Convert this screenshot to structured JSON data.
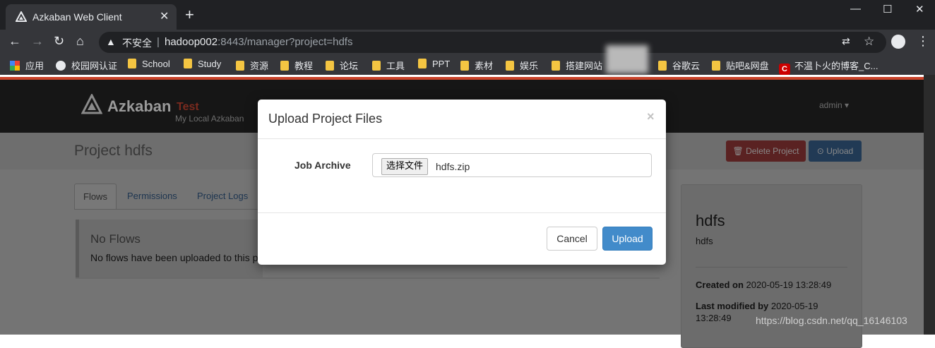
{
  "browser": {
    "tab_title": "Azkaban Web Client",
    "tab_close": "✕",
    "new_tab": "+",
    "insecure_label": "不安全",
    "url_host": "hadoop002",
    "url_rest": ":8443/manager?project=hdfs",
    "bookmarks": [
      {
        "label": "应用",
        "icon": "apps-grid-icon"
      },
      {
        "label": "校园网认证",
        "icon": "globe-icon"
      },
      {
        "label": "School",
        "icon": "folder-icon"
      },
      {
        "label": "Study",
        "icon": "folder-icon"
      },
      {
        "label": "资源",
        "icon": "folder-icon"
      },
      {
        "label": "教程",
        "icon": "folder-icon"
      },
      {
        "label": "论坛",
        "icon": "folder-icon"
      },
      {
        "label": "工具",
        "icon": "folder-icon"
      },
      {
        "label": "PPT",
        "icon": "folder-icon"
      },
      {
        "label": "素材",
        "icon": "folder-icon"
      },
      {
        "label": "娱乐",
        "icon": "folder-icon"
      },
      {
        "label": "搭建网站",
        "icon": "folder-icon"
      },
      {
        "label": "谷歌云",
        "icon": "folder-icon"
      },
      {
        "label": "贴吧&网盘",
        "icon": "folder-icon"
      },
      {
        "label": "不温卜火的博客_C...",
        "icon": "csdn-icon"
      }
    ]
  },
  "azkaban": {
    "brand": "Azkaban",
    "env": "Test",
    "subtitle": "My Local Azkaban",
    "user": "admin",
    "page_title": "Project hdfs",
    "delete_project": "Delete Project",
    "upload": "Upload",
    "tabs": [
      "Flows",
      "Permissions",
      "Project Logs"
    ],
    "no_flows_title": "No Flows",
    "no_flows_text": "No flows have been uploaded to this p",
    "project": {
      "name": "hdfs",
      "description": "hdfs",
      "created_label": "Created on",
      "created_value": "2020-05-19 13:28:49",
      "modified_label": "Last modified by",
      "modified_value": "2020-05-19",
      "modified_time": "13:28:49"
    }
  },
  "modal": {
    "title": "Upload Project Files",
    "close": "×",
    "field_label": "Job Archive",
    "choose_file": "选择文件",
    "file_name": "hdfs.zip",
    "cancel": "Cancel",
    "upload": "Upload"
  },
  "watermark": "https://blog.csdn.net/qq_16146103",
  "colors": {
    "chrome_dark": "#202124",
    "chrome_toolbar": "#35363a",
    "azkaban_accent": "#c9432a",
    "primary_button": "#428bca"
  }
}
